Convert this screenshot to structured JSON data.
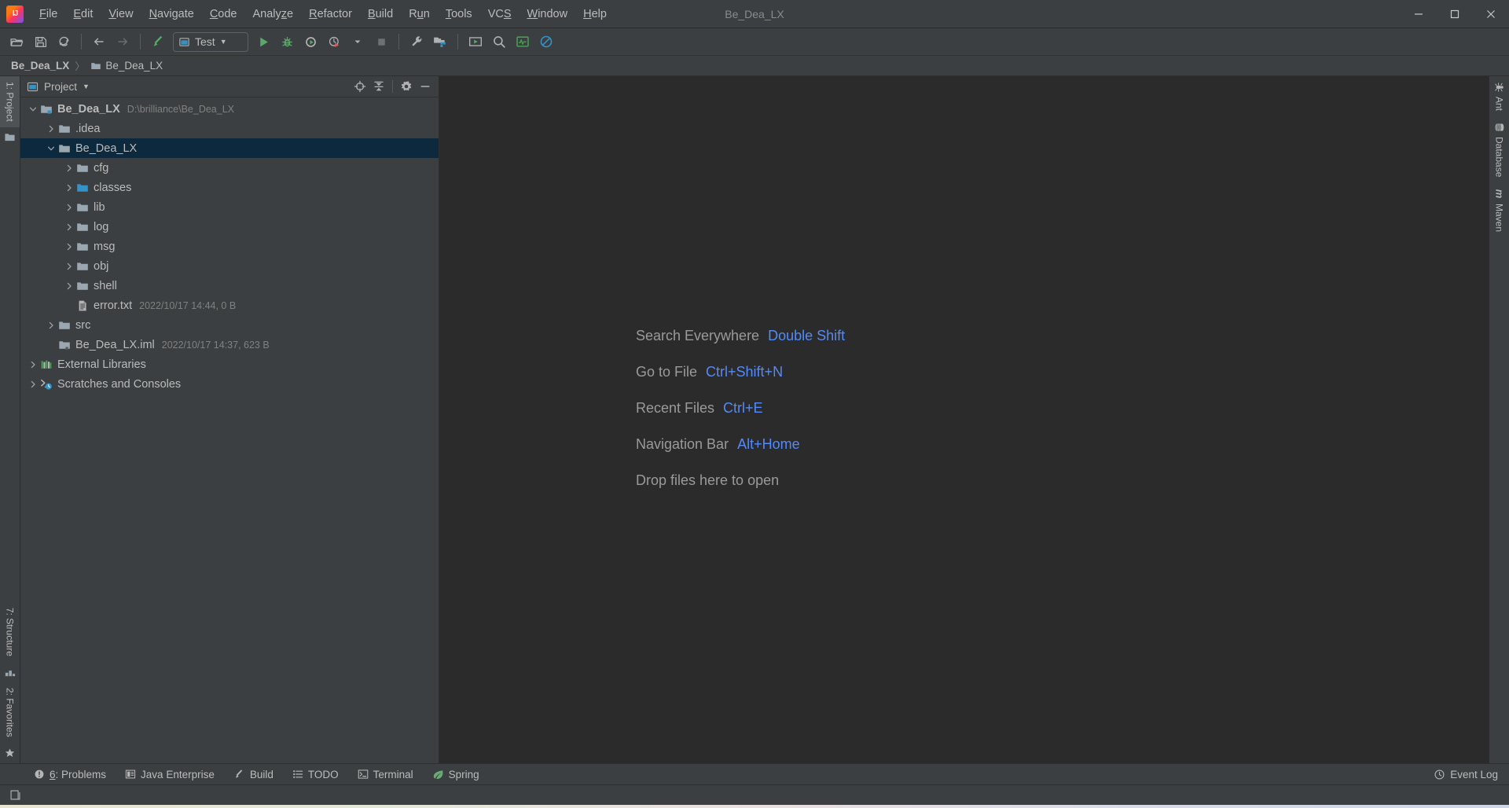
{
  "window": {
    "title": "Be_Dea_LX",
    "app_icon": "intellij-logo-icon",
    "minimize_label": "–",
    "maximize_label": "❐",
    "close_label": "✕"
  },
  "menu": {
    "items": [
      {
        "label": "File",
        "mnemonic": "F"
      },
      {
        "label": "Edit",
        "mnemonic": "E"
      },
      {
        "label": "View",
        "mnemonic": "V"
      },
      {
        "label": "Navigate",
        "mnemonic": "N"
      },
      {
        "label": "Code",
        "mnemonic": "C"
      },
      {
        "label": "Analyze",
        "mnemonic": "z"
      },
      {
        "label": "Refactor",
        "mnemonic": "R"
      },
      {
        "label": "Build",
        "mnemonic": "B"
      },
      {
        "label": "Run",
        "mnemonic": "u"
      },
      {
        "label": "Tools",
        "mnemonic": "T"
      },
      {
        "label": "VCS",
        "mnemonic": "S"
      },
      {
        "label": "Window",
        "mnemonic": "W"
      },
      {
        "label": "Help",
        "mnemonic": "H"
      }
    ]
  },
  "toolbar": {
    "buttons": [
      {
        "name": "open-folder-icon",
        "title": "Open"
      },
      {
        "name": "save-all-icon",
        "title": "Save All"
      },
      {
        "name": "sync-refresh-icon",
        "title": "Synchronize"
      },
      {
        "name": "back-arrow-icon",
        "title": "Back"
      },
      {
        "name": "forward-arrow-icon",
        "title": "Forward"
      },
      {
        "name": "build-hammer-icon",
        "title": "Build Project"
      }
    ],
    "run_config": {
      "label": "Test",
      "icon": "run-config-icon",
      "caret": "▼"
    },
    "run_buttons": [
      {
        "name": "run-icon",
        "title": "Run"
      },
      {
        "name": "debug-icon",
        "title": "Debug"
      },
      {
        "name": "run-with-coverage-icon",
        "title": "Run with Coverage"
      },
      {
        "name": "profile-icon",
        "title": "Profile"
      },
      {
        "name": "stop-icon",
        "title": "Stop"
      }
    ],
    "right_buttons": [
      {
        "name": "settings-wrench-icon",
        "title": "Settings"
      },
      {
        "name": "project-structure-icon",
        "title": "Project Structure"
      },
      {
        "name": "update-project-icon",
        "title": "Update Project"
      },
      {
        "name": "search-icon",
        "title": "Search Everywhere"
      },
      {
        "name": "activity-monitor-icon",
        "title": "Activity Monitor"
      },
      {
        "name": "no-access-icon",
        "title": "Disable"
      }
    ]
  },
  "breadcrumb": {
    "separator": "〉",
    "items": [
      {
        "label": "Be_Dea_LX",
        "bold": true,
        "icon": null
      },
      {
        "label": "Be_Dea_LX",
        "bold": false,
        "icon": "folder-icon"
      }
    ]
  },
  "left_rail": {
    "tabs": [
      {
        "label": "1: Project",
        "mnemonic": "1",
        "active": true,
        "name": "tool-tab-project"
      },
      {
        "label": "7: Structure",
        "mnemonic": "7",
        "active": false,
        "name": "tool-tab-structure"
      },
      {
        "label": "2: Favorites",
        "mnemonic": "2",
        "active": false,
        "name": "tool-tab-favorites"
      }
    ]
  },
  "right_rail": {
    "tabs": [
      {
        "label": "Ant",
        "icon": "ant-icon",
        "name": "tool-tab-ant"
      },
      {
        "label": "Database",
        "icon": "database-icon",
        "name": "tool-tab-database"
      },
      {
        "label": "Maven",
        "icon": "maven-icon",
        "name": "tool-tab-maven"
      }
    ]
  },
  "project_panel": {
    "title": "Project",
    "title_icon": "project-view-icon",
    "caret": "▼",
    "actions": [
      {
        "name": "locate-target-icon",
        "title": "Select Opened File"
      },
      {
        "name": "collapse-all-icon",
        "title": "Collapse All"
      },
      {
        "name": "settings-gear-icon",
        "title": "Show Options Menu"
      },
      {
        "name": "hide-panel-icon",
        "title": "Hide"
      }
    ],
    "tree": [
      {
        "label": "Be_Dea_LX",
        "meta": "D:\\brilliance\\Be_Dea_LX",
        "depth": 0,
        "arrow": "down",
        "icon": "module-root-icon",
        "bold": true,
        "selected": false
      },
      {
        "label": ".idea",
        "meta": "",
        "depth": 1,
        "arrow": "right",
        "icon": "folder-icon",
        "bold": false,
        "selected": false
      },
      {
        "label": "Be_Dea_LX",
        "meta": "",
        "depth": 1,
        "arrow": "down",
        "icon": "folder-icon",
        "bold": false,
        "selected": true
      },
      {
        "label": "cfg",
        "meta": "",
        "depth": 2,
        "arrow": "right",
        "icon": "folder-icon",
        "bold": false,
        "selected": false
      },
      {
        "label": "classes",
        "meta": "",
        "depth": 2,
        "arrow": "right",
        "icon": "folder-source-icon",
        "bold": false,
        "selected": false
      },
      {
        "label": "lib",
        "meta": "",
        "depth": 2,
        "arrow": "right",
        "icon": "folder-icon",
        "bold": false,
        "selected": false
      },
      {
        "label": "log",
        "meta": "",
        "depth": 2,
        "arrow": "right",
        "icon": "folder-icon",
        "bold": false,
        "selected": false
      },
      {
        "label": "msg",
        "meta": "",
        "depth": 2,
        "arrow": "right",
        "icon": "folder-icon",
        "bold": false,
        "selected": false
      },
      {
        "label": "obj",
        "meta": "",
        "depth": 2,
        "arrow": "right",
        "icon": "folder-icon",
        "bold": false,
        "selected": false
      },
      {
        "label": "shell",
        "meta": "",
        "depth": 2,
        "arrow": "right",
        "icon": "folder-icon",
        "bold": false,
        "selected": false
      },
      {
        "label": "error.txt",
        "meta": "2022/10/17 14:44, 0 B",
        "depth": 2,
        "arrow": "none",
        "icon": "text-file-icon",
        "bold": false,
        "selected": false
      },
      {
        "label": "src",
        "meta": "",
        "depth": 1,
        "arrow": "right",
        "icon": "folder-icon",
        "bold": false,
        "selected": false
      },
      {
        "label": "Be_Dea_LX.iml",
        "meta": "2022/10/17 14:37, 623 B",
        "depth": 1,
        "arrow": "none",
        "icon": "iml-file-icon",
        "bold": false,
        "selected": false
      },
      {
        "label": "External Libraries",
        "meta": "",
        "depth": 0,
        "arrow": "right",
        "icon": "libraries-icon",
        "bold": false,
        "selected": false
      },
      {
        "label": "Scratches and Consoles",
        "meta": "",
        "depth": 0,
        "arrow": "right",
        "icon": "scratches-icon",
        "bold": false,
        "selected": false
      }
    ]
  },
  "editor": {
    "hints": [
      {
        "name": "Search Everywhere",
        "key": "Double Shift"
      },
      {
        "name": "Go to File",
        "key": "Ctrl+Shift+N"
      },
      {
        "name": "Recent Files",
        "key": "Ctrl+E"
      },
      {
        "name": "Navigation Bar",
        "key": "Alt+Home"
      },
      {
        "name": "Drop files here to open",
        "key": ""
      }
    ]
  },
  "tool_window_bar": {
    "items": [
      {
        "label": "6: Problems",
        "mnemonic": "6",
        "icon": "problems-icon",
        "name": "tool-window-problems"
      },
      {
        "label": "Java Enterprise",
        "mnemonic": "",
        "icon": "java-enterprise-icon",
        "name": "tool-window-java-enterprise"
      },
      {
        "label": "Build",
        "mnemonic": "",
        "icon": "build-hammer-icon",
        "name": "tool-window-build"
      },
      {
        "label": "TODO",
        "mnemonic": "",
        "icon": "todo-list-icon",
        "name": "tool-window-todo"
      },
      {
        "label": "Terminal",
        "mnemonic": "",
        "icon": "terminal-icon",
        "name": "tool-window-terminal"
      },
      {
        "label": "Spring",
        "mnemonic": "",
        "icon": "spring-leaf-icon",
        "name": "tool-window-spring"
      }
    ],
    "event_log": {
      "label": "Event Log",
      "icon": "event-log-icon"
    }
  },
  "status_bar": {
    "icon": "layout-toggle-icon",
    "text": ""
  },
  "colors": {
    "panel_bg": "#3c3f41",
    "editor_bg": "#2b2b2b",
    "selection_bg": "#0d293e",
    "text": "#bbbbbb",
    "muted_text": "#808080",
    "accent_blue": "#548af7",
    "folder_gray": "#9aa7b0",
    "folder_teal": "#3592c4",
    "run_green": "#59a869"
  }
}
